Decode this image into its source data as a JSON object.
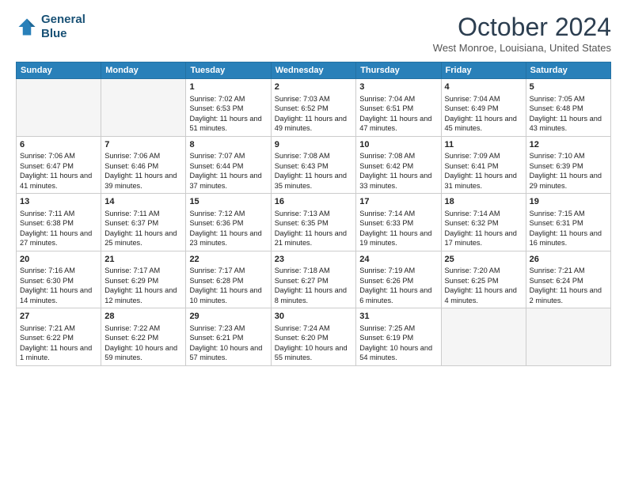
{
  "header": {
    "logo_line1": "General",
    "logo_line2": "Blue",
    "month": "October 2024",
    "location": "West Monroe, Louisiana, United States"
  },
  "days_of_week": [
    "Sunday",
    "Monday",
    "Tuesday",
    "Wednesday",
    "Thursday",
    "Friday",
    "Saturday"
  ],
  "weeks": [
    [
      {
        "day": "",
        "info": ""
      },
      {
        "day": "",
        "info": ""
      },
      {
        "day": "1",
        "info": "Sunrise: 7:02 AM\nSunset: 6:53 PM\nDaylight: 11 hours and 51 minutes."
      },
      {
        "day": "2",
        "info": "Sunrise: 7:03 AM\nSunset: 6:52 PM\nDaylight: 11 hours and 49 minutes."
      },
      {
        "day": "3",
        "info": "Sunrise: 7:04 AM\nSunset: 6:51 PM\nDaylight: 11 hours and 47 minutes."
      },
      {
        "day": "4",
        "info": "Sunrise: 7:04 AM\nSunset: 6:49 PM\nDaylight: 11 hours and 45 minutes."
      },
      {
        "day": "5",
        "info": "Sunrise: 7:05 AM\nSunset: 6:48 PM\nDaylight: 11 hours and 43 minutes."
      }
    ],
    [
      {
        "day": "6",
        "info": "Sunrise: 7:06 AM\nSunset: 6:47 PM\nDaylight: 11 hours and 41 minutes."
      },
      {
        "day": "7",
        "info": "Sunrise: 7:06 AM\nSunset: 6:46 PM\nDaylight: 11 hours and 39 minutes."
      },
      {
        "day": "8",
        "info": "Sunrise: 7:07 AM\nSunset: 6:44 PM\nDaylight: 11 hours and 37 minutes."
      },
      {
        "day": "9",
        "info": "Sunrise: 7:08 AM\nSunset: 6:43 PM\nDaylight: 11 hours and 35 minutes."
      },
      {
        "day": "10",
        "info": "Sunrise: 7:08 AM\nSunset: 6:42 PM\nDaylight: 11 hours and 33 minutes."
      },
      {
        "day": "11",
        "info": "Sunrise: 7:09 AM\nSunset: 6:41 PM\nDaylight: 11 hours and 31 minutes."
      },
      {
        "day": "12",
        "info": "Sunrise: 7:10 AM\nSunset: 6:39 PM\nDaylight: 11 hours and 29 minutes."
      }
    ],
    [
      {
        "day": "13",
        "info": "Sunrise: 7:11 AM\nSunset: 6:38 PM\nDaylight: 11 hours and 27 minutes."
      },
      {
        "day": "14",
        "info": "Sunrise: 7:11 AM\nSunset: 6:37 PM\nDaylight: 11 hours and 25 minutes."
      },
      {
        "day": "15",
        "info": "Sunrise: 7:12 AM\nSunset: 6:36 PM\nDaylight: 11 hours and 23 minutes."
      },
      {
        "day": "16",
        "info": "Sunrise: 7:13 AM\nSunset: 6:35 PM\nDaylight: 11 hours and 21 minutes."
      },
      {
        "day": "17",
        "info": "Sunrise: 7:14 AM\nSunset: 6:33 PM\nDaylight: 11 hours and 19 minutes."
      },
      {
        "day": "18",
        "info": "Sunrise: 7:14 AM\nSunset: 6:32 PM\nDaylight: 11 hours and 17 minutes."
      },
      {
        "day": "19",
        "info": "Sunrise: 7:15 AM\nSunset: 6:31 PM\nDaylight: 11 hours and 16 minutes."
      }
    ],
    [
      {
        "day": "20",
        "info": "Sunrise: 7:16 AM\nSunset: 6:30 PM\nDaylight: 11 hours and 14 minutes."
      },
      {
        "day": "21",
        "info": "Sunrise: 7:17 AM\nSunset: 6:29 PM\nDaylight: 11 hours and 12 minutes."
      },
      {
        "day": "22",
        "info": "Sunrise: 7:17 AM\nSunset: 6:28 PM\nDaylight: 11 hours and 10 minutes."
      },
      {
        "day": "23",
        "info": "Sunrise: 7:18 AM\nSunset: 6:27 PM\nDaylight: 11 hours and 8 minutes."
      },
      {
        "day": "24",
        "info": "Sunrise: 7:19 AM\nSunset: 6:26 PM\nDaylight: 11 hours and 6 minutes."
      },
      {
        "day": "25",
        "info": "Sunrise: 7:20 AM\nSunset: 6:25 PM\nDaylight: 11 hours and 4 minutes."
      },
      {
        "day": "26",
        "info": "Sunrise: 7:21 AM\nSunset: 6:24 PM\nDaylight: 11 hours and 2 minutes."
      }
    ],
    [
      {
        "day": "27",
        "info": "Sunrise: 7:21 AM\nSunset: 6:22 PM\nDaylight: 11 hours and 1 minute."
      },
      {
        "day": "28",
        "info": "Sunrise: 7:22 AM\nSunset: 6:22 PM\nDaylight: 10 hours and 59 minutes."
      },
      {
        "day": "29",
        "info": "Sunrise: 7:23 AM\nSunset: 6:21 PM\nDaylight: 10 hours and 57 minutes."
      },
      {
        "day": "30",
        "info": "Sunrise: 7:24 AM\nSunset: 6:20 PM\nDaylight: 10 hours and 55 minutes."
      },
      {
        "day": "31",
        "info": "Sunrise: 7:25 AM\nSunset: 6:19 PM\nDaylight: 10 hours and 54 minutes."
      },
      {
        "day": "",
        "info": ""
      },
      {
        "day": "",
        "info": ""
      }
    ]
  ]
}
